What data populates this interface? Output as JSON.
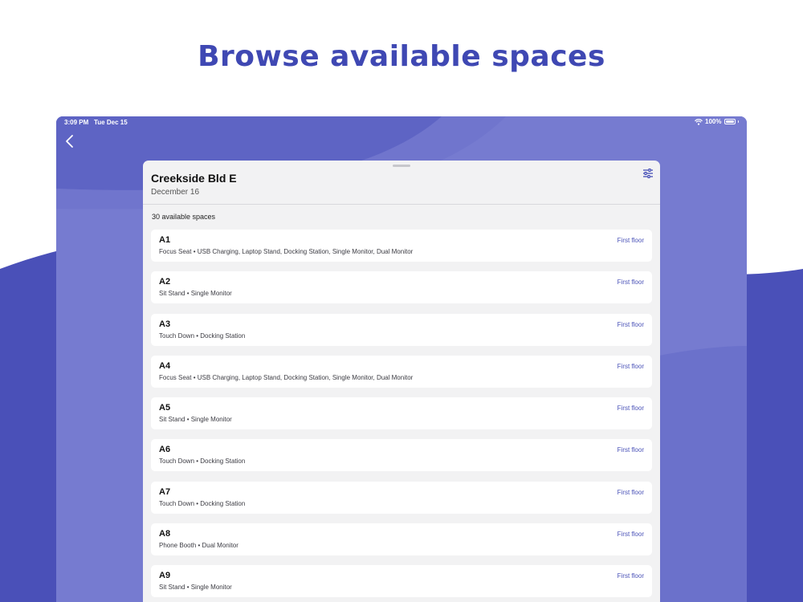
{
  "headline": "Browse available spaces",
  "colors": {
    "accent": "#3f48b3",
    "device_background": "#6f74cc",
    "wave_dark": "#4a50b8",
    "floor_link": "#4a52b8"
  },
  "status_bar": {
    "time": "3:09 PM",
    "date": "Tue Dec 15",
    "battery": "100%"
  },
  "icons": {
    "back": "chevron-left-icon",
    "filter": "sliders-icon",
    "wifi": "wifi-icon",
    "battery": "battery-icon"
  },
  "sheet": {
    "title": "Creekside Bld E",
    "subtitle": "December 16",
    "count_label": "30 available spaces"
  },
  "spaces": [
    {
      "name": "A1",
      "desc": "Focus Seat • USB Charging, Laptop Stand, Docking Station, Single Monitor, Dual Monitor",
      "floor": "First floor"
    },
    {
      "name": "A2",
      "desc": "Sit Stand • Single Monitor",
      "floor": "First floor"
    },
    {
      "name": "A3",
      "desc": "Touch Down • Docking Station",
      "floor": "First floor"
    },
    {
      "name": "A4",
      "desc": "Focus Seat • USB Charging, Laptop Stand, Docking Station, Single Monitor, Dual Monitor",
      "floor": "First floor"
    },
    {
      "name": "A5",
      "desc": "Sit Stand • Single Monitor",
      "floor": "First floor"
    },
    {
      "name": "A6",
      "desc": "Touch Down • Docking Station",
      "floor": "First floor"
    },
    {
      "name": "A7",
      "desc": "Touch Down • Docking Station",
      "floor": "First floor"
    },
    {
      "name": "A8",
      "desc": "Phone Booth • Dual Monitor",
      "floor": "First floor"
    },
    {
      "name": "A9",
      "desc": "Sit Stand • Single Monitor",
      "floor": "First floor"
    }
  ]
}
